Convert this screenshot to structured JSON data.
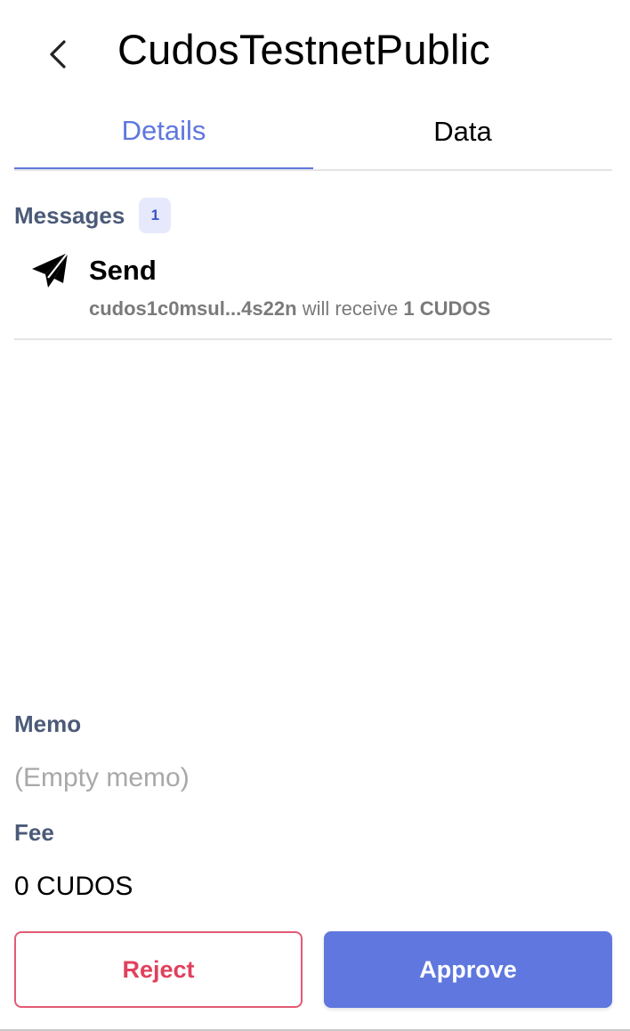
{
  "header": {
    "title": "CudosTestnetPublic",
    "back_icon": "chevron-left-icon"
  },
  "tabs": [
    {
      "label": "Details",
      "active": true
    },
    {
      "label": "Data",
      "active": false
    }
  ],
  "messages": {
    "label": "Messages",
    "count": "1",
    "items": [
      {
        "icon": "paper-plane-icon",
        "title": "Send",
        "recipient": "cudos1c0msul...4s22n",
        "action_text": "will receive",
        "amount": "1 CUDOS"
      }
    ]
  },
  "memo": {
    "label": "Memo",
    "value": "(Empty memo)"
  },
  "fee": {
    "label": "Fee",
    "value": "0 CUDOS"
  },
  "actions": {
    "reject_label": "Reject",
    "approve_label": "Approve"
  },
  "colors": {
    "accent": "#5f77de",
    "reject": "#e0415d",
    "section_label": "#4b5a78"
  }
}
